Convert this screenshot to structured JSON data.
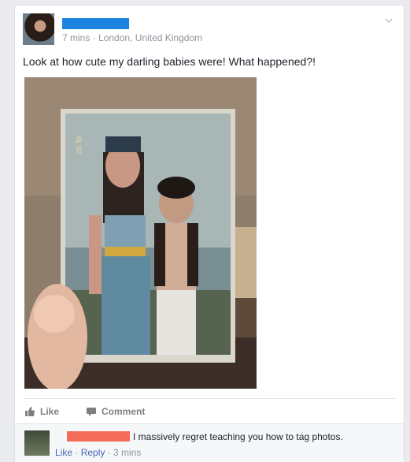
{
  "post": {
    "time": "7 mins",
    "separator": " · ",
    "location": "London, United Kingdom",
    "text": "Look at how cute my darling babies were! What happened?!",
    "photo_label": "8L 92"
  },
  "actions": {
    "like_label": "Like",
    "comment_label": "Comment"
  },
  "comment": {
    "text": "I massively regret teaching you how to tag photos.",
    "like_label": "Like",
    "sep1": " · ",
    "reply_label": "Reply",
    "sep2": " · ",
    "time": "3 mins"
  },
  "colors": {
    "name_redaction": "#1d83e0",
    "commenter_redaction": "#f36c5b",
    "link": "#4267b2"
  },
  "icons": [
    "chevron-down-icon",
    "thumbs-up-icon",
    "comment-icon"
  ]
}
